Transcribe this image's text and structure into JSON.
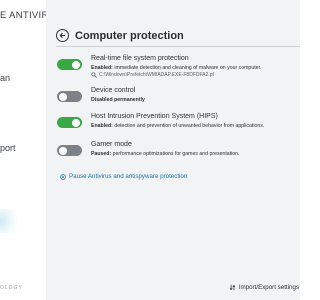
{
  "sidebar": {
    "app_title": "E ANTIVIRUS",
    "fragment_1": "an",
    "fragment_2": "port",
    "brand_footer": "OLOGY"
  },
  "main": {
    "title": "Computer protection",
    "items": [
      {
        "name": "Real-time file system protection",
        "state": "on",
        "status_label": "Enabled:",
        "status_text": " immediate detection and cleaning of malware on your computer.",
        "path": "C:\\Windows\\Prefetch\\WMIADAP.EXE-F8DFDFA2.pf"
      },
      {
        "name": "Device control",
        "state": "off",
        "status_label": "Disabled permanently",
        "status_text": ""
      },
      {
        "name": "Host Intrusion Prevention System (HIPS)",
        "state": "on",
        "status_label": "Enabled:",
        "status_text": " detection and prevention of unwanted behavior from applications."
      },
      {
        "name": "Gamer mode",
        "state": "off",
        "status_label": "Paused:",
        "status_text": " performance optimizations for games and presentation."
      }
    ],
    "pause_link": "Pause Antivirus and antispyware protection",
    "footer_link": "Import/Export settings"
  },
  "colors": {
    "toggle_on": "#39a845",
    "toggle_off": "#7c8287",
    "link": "#1673a5",
    "panel_bg": "#f2f3f4"
  },
  "icons": [
    "back-arrow-icon",
    "magnifier-icon",
    "pause-icon",
    "import-export-icon"
  ]
}
